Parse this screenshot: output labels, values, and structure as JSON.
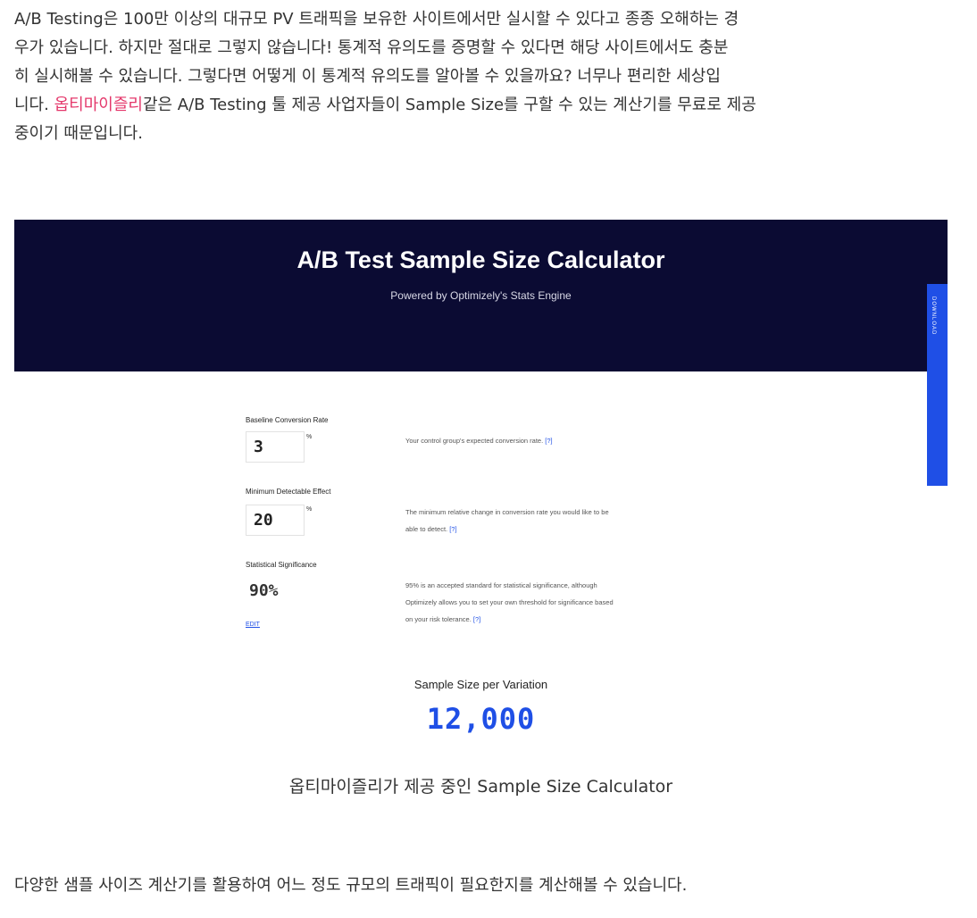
{
  "intro": {
    "line1": "A/B Testing은 100만 이상의 대규모 PV 트래픽을 보유한 사이트에서만 실시할 수 있다고 종종 오해하는 경",
    "line2": "우가 있습니다. 하지만 절대로 그렇지 않습니다! 통계적 유의도를 증명할 수 있다면 해당 사이트에서도 충분",
    "line3": "히 실시해볼 수 있습니다. 그렇다면 어떻게 이 통계적 유의도를 알아볼 수 있을까요? 너무나 편리한 세상입",
    "line4_prefix": "니다. ",
    "line4_link": "옵티마이즐리",
    "line4_suffix": "같은 A/B Testing 툴 제공 사업자들이 Sample Size를 구할 수 있는 계산기를 무료로 제공",
    "line5": "중이기 때문입니다.",
    "link_color": "#e4386b"
  },
  "calculator": {
    "title": "A/B Test Sample Size Calculator",
    "subtitle": "Powered by Optimizely's Stats Engine",
    "download_label": "DOWNLOAD",
    "header_color": "#0b0b33",
    "accent_color": "#1f4fe6",
    "baseline": {
      "label": "Baseline Conversion Rate",
      "value": "3",
      "unit": "%",
      "help": "Your control group's expected conversion rate.",
      "help_link": "[?]"
    },
    "mde": {
      "label": "Minimum Detectable Effect",
      "value": "20",
      "unit": "%",
      "help_line1": "The minimum relative change in conversion rate you would like to be",
      "help_line2": "able to detect.",
      "help_link": "[?]"
    },
    "significance": {
      "label": "Statistical Significance",
      "value": "90%",
      "edit_label": "EDIT",
      "help_line1": "95% is an accepted standard for statistical significance, although",
      "help_line2": "Optimizely allows you to set your own threshold for significance based",
      "help_line3": "on your risk tolerance.",
      "help_link": "[?]"
    },
    "result": {
      "label": "Sample Size per Variation",
      "value": "12,000"
    }
  },
  "caption": "옵티마이즐리가 제공 중인 Sample Size Calculator",
  "closing": "다양한 샘플 사이즈 계산기를 활용하여 어느 정도 규모의 트래픽이 필요한지를 계산해볼 수 있습니다."
}
